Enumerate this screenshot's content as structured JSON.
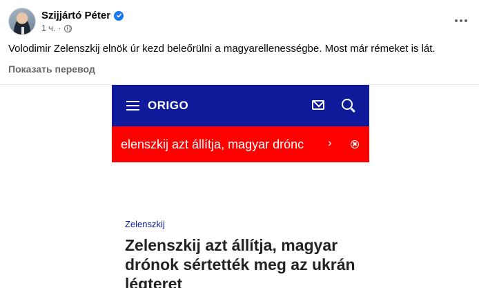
{
  "post": {
    "author": "Szijjártó Péter",
    "time": "1 ч.",
    "separator": "·",
    "text": "Volodimir Zelenszkij elnök úr kezd beleőrülni a magyarellenességbe. Most már rémeket is lát.",
    "translate_label": "Показать перевод"
  },
  "shared": {
    "site_logo": "ORIGO",
    "ticker_text": "elenszkij azt állítja, magyar drónc",
    "ticker_arrow": "›",
    "category": "Zelenszkij",
    "title": "Zelenszkij azt állítja, magyar drónok sértették meg az ukrán légteret"
  },
  "colors": {
    "facebook_blue": "#1877f2",
    "origo_nav": "#0e1a9a",
    "ticker_red": "#fe0000"
  },
  "icons": [
    "verified-icon",
    "globe-icon",
    "more-icon",
    "hamburger-icon",
    "mail-icon",
    "search-icon",
    "chevron-right-icon",
    "close-icon"
  ]
}
